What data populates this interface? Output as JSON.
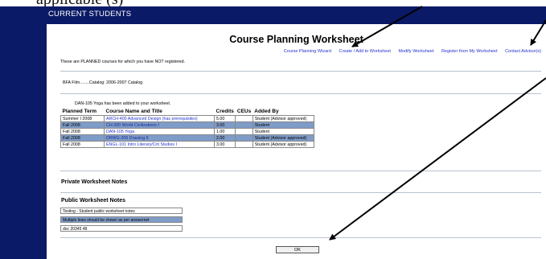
{
  "caption_fragment": "applicable  (s)",
  "window": {
    "title": "Current Students"
  },
  "page": {
    "title": "Course Planning Worksheet"
  },
  "nav": [
    "Course Planning Wizard",
    "Create / Add to Worksheet",
    "Modify Worksheet",
    "Register from My Worksheet",
    "Contact Advisor(s)"
  ],
  "info_text": "These are PLANNED courses for which you have NOT registered.",
  "catalog_text": "BFA Film........Catalog: 2006-2007 Catalog",
  "added_message": "DAN-105 Yoga has been added to your worksheet.",
  "table": {
    "headers": [
      "Planned Term",
      "Course Name and Title",
      "Credits",
      "CEUs",
      "Added By"
    ],
    "rows": [
      {
        "term": "Summer I 2008",
        "course": "ARCH-400 Advanced Design (has prerequisites)",
        "credits": "5.00",
        "ceus": "",
        "added_by": "Student (Advisor approved)",
        "highlight": false
      },
      {
        "term": "Fall 2008",
        "course": "CH-300 World Civilizations I",
        "credits": "3.00",
        "ceus": "",
        "added_by": "Student",
        "highlight": true
      },
      {
        "term": "Fall 2008",
        "course": "DAN-105 Yoga",
        "credits": "1.00",
        "ceus": "",
        "added_by": "Student",
        "highlight": false
      },
      {
        "term": "Fall 2008",
        "course": "DRWG-206 Drawing II",
        "credits": "2.00",
        "ceus": "",
        "added_by": "Student (Advisor approved)",
        "highlight": true
      },
      {
        "term": "Fall 2008",
        "course": "ENGL-101 Intro Literary/Crit Studies I",
        "credits": "3.00",
        "ceus": "",
        "added_by": "Student (Advisor approved)",
        "highlight": false
      }
    ]
  },
  "private_notes": {
    "title": "Private Worksheet Notes"
  },
  "public_notes": {
    "title": "Public Worksheet Notes",
    "lines": [
      "Testing - Student public worksheet notes",
      "Multiple lines should be shown as per answernet",
      "doc 20345 48"
    ]
  },
  "ok_label": "OK",
  "colors": {
    "frame": "#0b1a66",
    "row_highlight": "#7f9cc8",
    "link": "#2233cc"
  }
}
